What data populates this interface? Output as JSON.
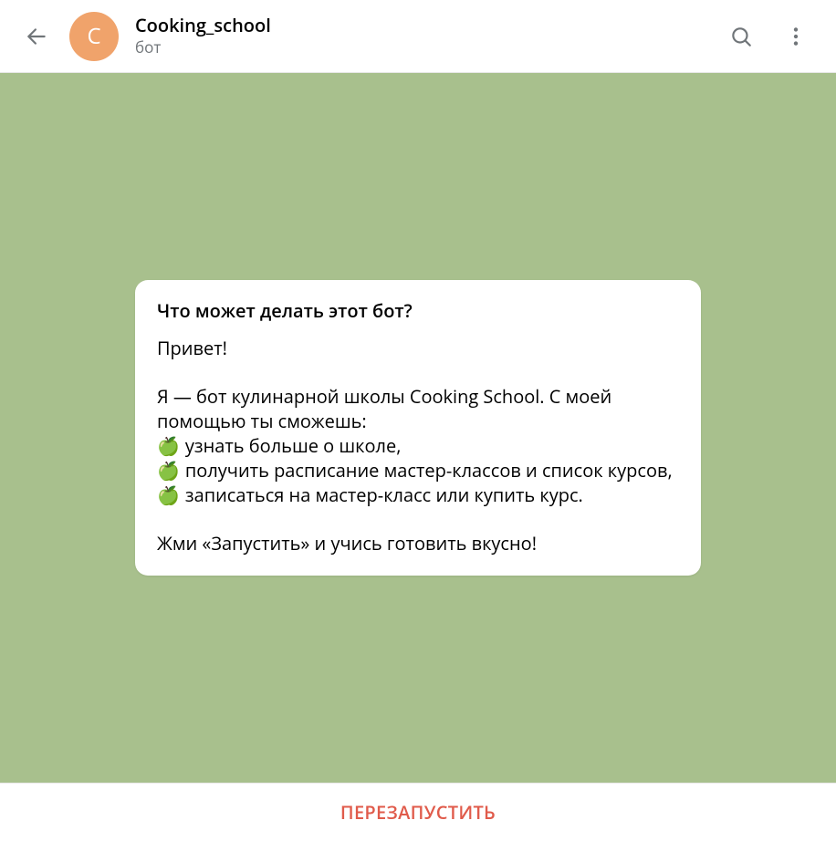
{
  "header": {
    "avatar_initial": "C",
    "title": "Cooking_school",
    "subtitle": "бот"
  },
  "card": {
    "title": "Что может делать этот бот?",
    "greeting": "Привет!",
    "intro": "Я — бот кулинарной школы Cooking School. С моей помощью ты сможешь:",
    "bullets": [
      "узнать больше о школе,",
      "получить расписание мастер-классов и список курсов,",
      "записаться на мастер-класс или купить курс."
    ],
    "bullet_icon": "🍏",
    "cta": "Жми «Запустить» и учись готовить вкусно!"
  },
  "bottom": {
    "restart_label": "ПЕРЕЗАПУСТИТЬ"
  },
  "colors": {
    "chat_bg": "#a8c08d",
    "avatar_bg": "#f0a36b",
    "accent_red": "#e05b4b",
    "muted": "#707579"
  }
}
